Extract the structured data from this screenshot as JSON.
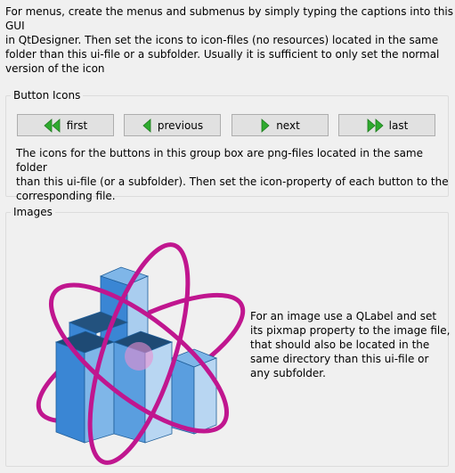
{
  "intro": {
    "lines": [
      "For menus, create the menus and submenus by simply typing the captions into this GUI",
      "in QtDesigner. Then set the icons to icon-files (no resources) located in the same",
      "folder than this ui-file or a subfolder. Usually it is sufficient to only set the normal",
      "version of the icon"
    ]
  },
  "button_icons": {
    "title": "Button Icons",
    "buttons": [
      {
        "label": "first",
        "icon": "double-left-arrow-icon"
      },
      {
        "label": "previous",
        "icon": "left-arrow-icon"
      },
      {
        "label": "next",
        "icon": "right-arrow-icon"
      },
      {
        "label": "last",
        "icon": "double-right-arrow-icon"
      }
    ],
    "description_lines": [
      "The icons for the buttons in this group box are png-files located in the same folder",
      "than this ui-file (or a subfolder). Then set the icon-property of each button to the",
      "corresponding file."
    ]
  },
  "images": {
    "title": "Images",
    "image_icon": "atom-cubes-logo",
    "description_lines": [
      "For an image use a QLabel and set",
      "its pixmap property to the image file,",
      "that should also be located in the",
      "same directory than this ui-file or",
      "any subfolder."
    ]
  },
  "colors": {
    "arrow_green": "#2eaa2e",
    "orbit_magenta": "#c0168f",
    "cube_blue": "#3a86d4"
  }
}
